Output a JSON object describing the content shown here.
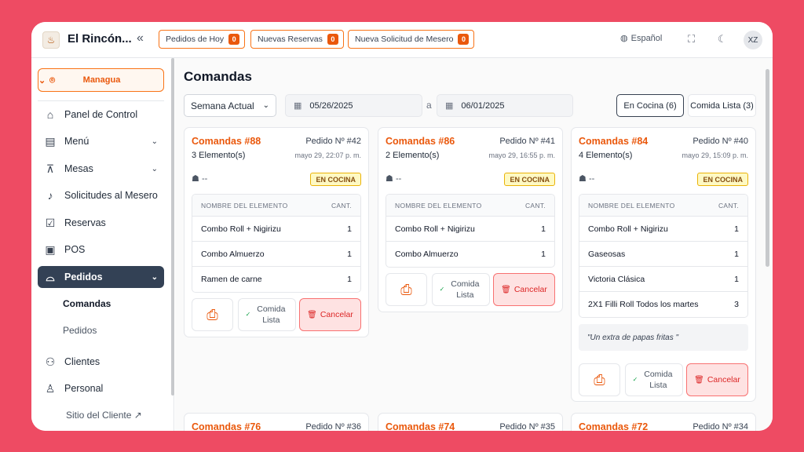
{
  "topbar": {
    "brand": "El Rincón...",
    "pills": [
      {
        "label": "Pedidos de Hoy",
        "count": "0"
      },
      {
        "label": "Nuevas Reservas",
        "count": "0"
      },
      {
        "label": "Nueva Solicitud de Mesero",
        "count": "0"
      }
    ],
    "language": "Español",
    "avatar": "XZ"
  },
  "sidebar": {
    "location": "Managua",
    "items": [
      {
        "label": "Panel de Control",
        "icon": "home-icon"
      },
      {
        "label": "Menú",
        "icon": "menu-book-icon"
      },
      {
        "label": "Mesas",
        "icon": "table-icon"
      },
      {
        "label": "Solicitudes al Mesero",
        "icon": "bell-icon"
      },
      {
        "label": "Reservas",
        "icon": "calendar-check-icon"
      },
      {
        "label": "POS",
        "icon": "pos-icon"
      },
      {
        "label": "Pedidos",
        "icon": "cloche-icon"
      }
    ],
    "subitems": [
      {
        "label": "Comandas"
      },
      {
        "label": "Pedidos"
      }
    ],
    "items2": [
      {
        "label": "Clientes",
        "icon": "users-icon"
      },
      {
        "label": "Personal",
        "icon": "user-icon"
      }
    ],
    "client_site": "Sitio del Cliente"
  },
  "main": {
    "title": "Comandas",
    "range_select": "Semana Actual",
    "date_from": "05/26/2025",
    "date_sep": "a",
    "date_to": "06/01/2025",
    "filters": [
      {
        "label": "En Cocina (6)",
        "active": true
      },
      {
        "label": "Comida Lista (3)",
        "active": false
      }
    ],
    "table_header": {
      "name": "NOMBRE DEL ELEMENTO",
      "qty": "CANT."
    },
    "labels": {
      "status": "EN COCINA",
      "ready": "Comida Lista",
      "cancel": "Cancelar",
      "dash": "--"
    },
    "cards": [
      {
        "name": "Comandas #88",
        "order": "Pedido Nº #42",
        "items_count": "3 Elemento(s)",
        "datetime": "mayo 29, 22:07 p. m.",
        "rows": [
          {
            "item": "Combo Roll + Nigirizu",
            "qty": "1"
          },
          {
            "item": "Combo Almuerzo",
            "qty": "1"
          },
          {
            "item": "Ramen de carne",
            "qty": "1"
          }
        ]
      },
      {
        "name": "Comandas #86",
        "order": "Pedido Nº #41",
        "items_count": "2 Elemento(s)",
        "datetime": "mayo 29, 16:55 p. m.",
        "rows": [
          {
            "item": "Combo Roll + Nigirizu",
            "qty": "1"
          },
          {
            "item": "Combo Almuerzo",
            "qty": "1"
          }
        ]
      },
      {
        "name": "Comandas #84",
        "order": "Pedido Nº #40",
        "items_count": "4 Elemento(s)",
        "datetime": "mayo 29, 15:09 p. m.",
        "rows": [
          {
            "item": "Combo Roll + Nigirizu",
            "qty": "1"
          },
          {
            "item": "Gaseosas",
            "qty": "1"
          },
          {
            "item": "Victoria Clásica",
            "qty": "1"
          },
          {
            "item": "2X1 Filli Roll Todos los martes",
            "qty": "3"
          }
        ],
        "note": "\"Un extra de papas fritas \""
      },
      {
        "name": "Comandas #76",
        "order": "Pedido Nº #36"
      },
      {
        "name": "Comandas #74",
        "order": "Pedido Nº #35"
      },
      {
        "name": "Comandas #72",
        "order": "Pedido Nº #34"
      }
    ]
  },
  "colors": {
    "background": "#ee4b63",
    "accent": "#ea580c",
    "sidebar_active": "#334155",
    "cancel": "#dc2626"
  }
}
